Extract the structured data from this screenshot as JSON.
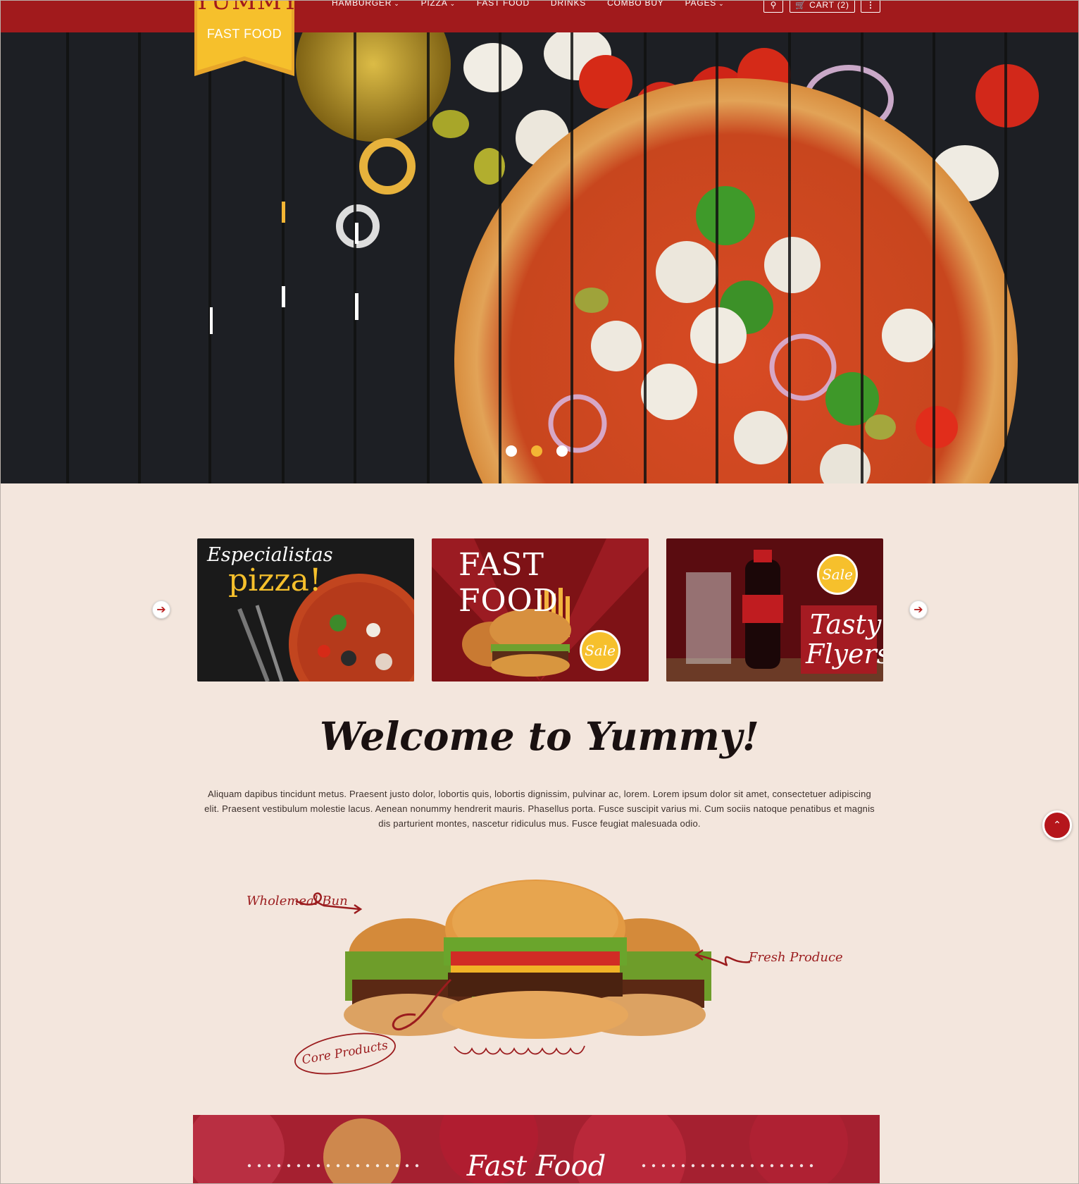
{
  "colors": {
    "brand_red": "#a11a1c",
    "accent_yellow": "#f6c02c",
    "page_bg": "#f3e6dd"
  },
  "logo": {
    "brand": "YUMMY",
    "tagline": "FAST FOOD"
  },
  "nav": {
    "items": [
      {
        "label": "HAMBURGER",
        "dropdown": true
      },
      {
        "label": "PIZZA",
        "dropdown": true
      },
      {
        "label": "FAST FOOD",
        "dropdown": false
      },
      {
        "label": "DRINKS",
        "dropdown": false
      },
      {
        "label": "COMBO BUY",
        "dropdown": false
      },
      {
        "label": "PAGES",
        "dropdown": true
      }
    ],
    "cart_label": "CART",
    "cart_count": "(2)",
    "search_icon": "search-icon",
    "more_icon": "more-vertical-icon"
  },
  "slider": {
    "dot_count": 3,
    "active_dot": 2
  },
  "promos": [
    {
      "line1": "Especialistas",
      "line2": "pizza!"
    },
    {
      "title": "FAST FOOD",
      "badge": "Sale"
    },
    {
      "line1": "Tasty",
      "line2": "Flyers",
      "badge": "Sale"
    }
  ],
  "welcome": {
    "title": "Welcome to Yummy!",
    "text": "Aliquam dapibus tincidunt metus. Praesent justo dolor, lobortis quis, lobortis dignissim, pulvinar ac, lorem. Lorem ipsum dolor sit amet, consectetuer adipiscing elit. Praesent vestibulum molestie lacus. Aenean nonummy hendrerit mauris. Phasellus porta. Fusce suscipit varius mi. Cum sociis natoque penatibus et magnis dis parturient montes, nascetur ridiculus mus. Fusce feugiat malesuada odio."
  },
  "burger_labels": {
    "bun": "Wholemeal Bun",
    "fresh": "Fresh Produce",
    "core": "Core Products"
  },
  "banner": {
    "title": "Fast Food"
  },
  "icons": {
    "prev": "arrow-left-icon",
    "next": "arrow-right-icon",
    "chat": "chevron-up-icon",
    "cart": "cart-icon"
  }
}
